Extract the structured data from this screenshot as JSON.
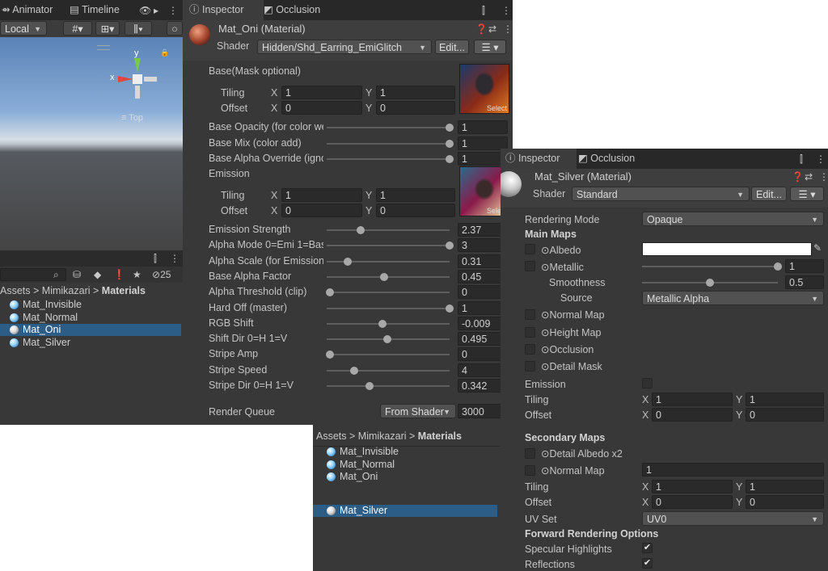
{
  "scene": {
    "tabs": [
      {
        "label": "Animator"
      },
      {
        "label": "Timeline"
      }
    ],
    "toolbar": {
      "local_label": "Local"
    },
    "gizmo": {
      "y": "y",
      "x": "x",
      "view_label": "Top"
    }
  },
  "project": {
    "badge": "25",
    "breadcrumb": [
      "Assets",
      "Mimikazari",
      "Materials"
    ],
    "items": [
      "Mat_Invisible",
      "Mat_Normal",
      "Mat_Oni",
      "Mat_Silver"
    ],
    "selected": "Mat_Oni"
  },
  "oni": {
    "tabs": [
      "Inspector",
      "Occlusion"
    ],
    "title": "Mat_Oni (Material)",
    "shader_label": "Shader",
    "shader_value": "Hidden/Shd_Earring_EmiGlitch",
    "edit_label": "Edit...",
    "base_section": "Base(Mask optional)",
    "tiling_label": "Tiling",
    "offset_label": "Offset",
    "x_label": "X",
    "y_label": "Y",
    "base_tiling": {
      "x": "1",
      "y": "1"
    },
    "base_offset": {
      "x": "0",
      "y": "0"
    },
    "select_label": "Select",
    "sliders_a": [
      {
        "label": "Base Opacity (for color we",
        "value": "1",
        "pos": 1.0
      },
      {
        "label": "Base Mix (color add)",
        "value": "1",
        "pos": 1.0
      },
      {
        "label": "Base Alpha Override (igno",
        "value": "1",
        "pos": 1.0
      }
    ],
    "emission_section": "Emission",
    "emi_tiling": {
      "x": "1",
      "y": "1"
    },
    "emi_offset": {
      "x": "0",
      "y": "0"
    },
    "sliders_b": [
      {
        "label": "Emission Strength",
        "value": "2.37",
        "pos": 0.26
      },
      {
        "label": "Alpha Mode 0=Emi 1=Bas",
        "value": "3",
        "pos": 1.0
      },
      {
        "label": "Alpha Scale (for Emission)",
        "value": "0.31",
        "pos": 0.15
      },
      {
        "label": "Base Alpha Factor",
        "value": "0.45",
        "pos": 0.45
      },
      {
        "label": "Alpha Threshold (clip)",
        "value": "0",
        "pos": 0.0
      },
      {
        "label": "Hard Off (master)",
        "value": "1",
        "pos": 1.0
      },
      {
        "label": "RGB Shift",
        "value": "-0.009",
        "pos": 0.44
      },
      {
        "label": "Shift Dir 0=H 1=V",
        "value": "0.495",
        "pos": 0.48
      },
      {
        "label": "Stripe Amp",
        "value": "0",
        "pos": 0.0
      },
      {
        "label": "Stripe Speed",
        "value": "4",
        "pos": 0.2
      },
      {
        "label": "Stripe Dir 0=H 1=V",
        "value": "0.342",
        "pos": 0.33
      }
    ],
    "render_queue_label": "Render Queue",
    "render_queue_mode": "From Shader",
    "render_queue_value": "3000"
  },
  "project2": {
    "breadcrumb": [
      "Assets",
      "Mimikazari",
      "Materials"
    ],
    "items": [
      "Mat_Invisible",
      "Mat_Normal",
      "Mat_Oni",
      "Mat_Silver"
    ],
    "selected": "Mat_Silver"
  },
  "silver": {
    "tabs": [
      "Inspector",
      "Occlusion"
    ],
    "title": "Mat_Silver (Material)",
    "shader_label": "Shader",
    "shader_value": "Standard",
    "edit_label": "Edit...",
    "rendering_mode_label": "Rendering Mode",
    "rendering_mode_value": "Opaque",
    "main_maps": "Main Maps",
    "albedo": "Albedo",
    "metallic": "Metallic",
    "metallic_value": "1",
    "metallic_pos": 1.0,
    "smoothness": "Smoothness",
    "smoothness_value": "0.5",
    "smoothness_pos": 0.5,
    "source": "Source",
    "source_value": "Metallic Alpha",
    "normal_map": "Normal Map",
    "height_map": "Height Map",
    "occlusion": "Occlusion",
    "detail_mask": "Detail Mask",
    "emission": "Emission",
    "tiling_label": "Tiling",
    "offset_label": "Offset",
    "x_label": "X",
    "y_label": "Y",
    "main_tiling": {
      "x": "1",
      "y": "1"
    },
    "main_offset": {
      "x": "0",
      "y": "0"
    },
    "secondary_maps": "Secondary Maps",
    "detail_albedo": "Detail Albedo x2",
    "normal_map2": "Normal Map",
    "normal_map2_value": "1",
    "sec_tiling": {
      "x": "1",
      "y": "1"
    },
    "sec_offset": {
      "x": "0",
      "y": "0"
    },
    "uv_set_label": "UV Set",
    "uv_set_value": "UV0",
    "forward_label": "Forward Rendering Options",
    "specular_label": "Specular Highlights",
    "reflections_label": "Reflections"
  },
  "colors": {
    "selection": "#2c5d87",
    "panel": "#383838",
    "tabbar": "#282828",
    "albedo_swatch": "#ffffff"
  }
}
